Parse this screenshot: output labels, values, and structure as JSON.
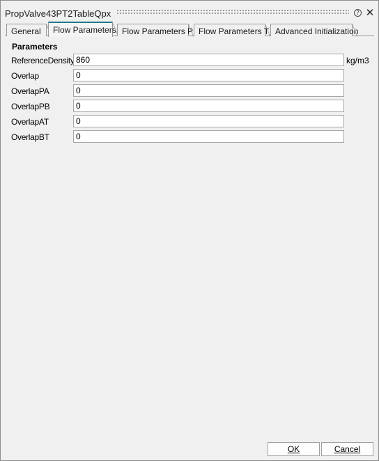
{
  "window": {
    "title": "PropValve43PT2TableQpx",
    "help_glyph": "?",
    "close_glyph": "✕"
  },
  "tabs": [
    {
      "label": "General",
      "active": false
    },
    {
      "label": "Flow Parameters",
      "active": true
    },
    {
      "label": "Flow Parameters P",
      "active": false
    },
    {
      "label": "Flow Parameters T",
      "active": false
    },
    {
      "label": "Advanced Initialization",
      "active": false
    }
  ],
  "section": {
    "title": "Parameters"
  },
  "parameters": [
    {
      "label": "ReferenceDensity",
      "value": "860",
      "unit": "kg/m3"
    },
    {
      "label": "Overlap",
      "value": "0",
      "unit": ""
    },
    {
      "label": "OverlapPA",
      "value": "0",
      "unit": ""
    },
    {
      "label": "OverlapPB",
      "value": "0",
      "unit": ""
    },
    {
      "label": "OverlapAT",
      "value": "0",
      "unit": ""
    },
    {
      "label": "OverlapBT",
      "value": "0",
      "unit": ""
    }
  ],
  "buttons": {
    "ok_label": "OK",
    "cancel_label": "Cancel"
  },
  "colors": {
    "active_tab_accent": "#1e7b8c",
    "background": "#f0f0f0"
  }
}
